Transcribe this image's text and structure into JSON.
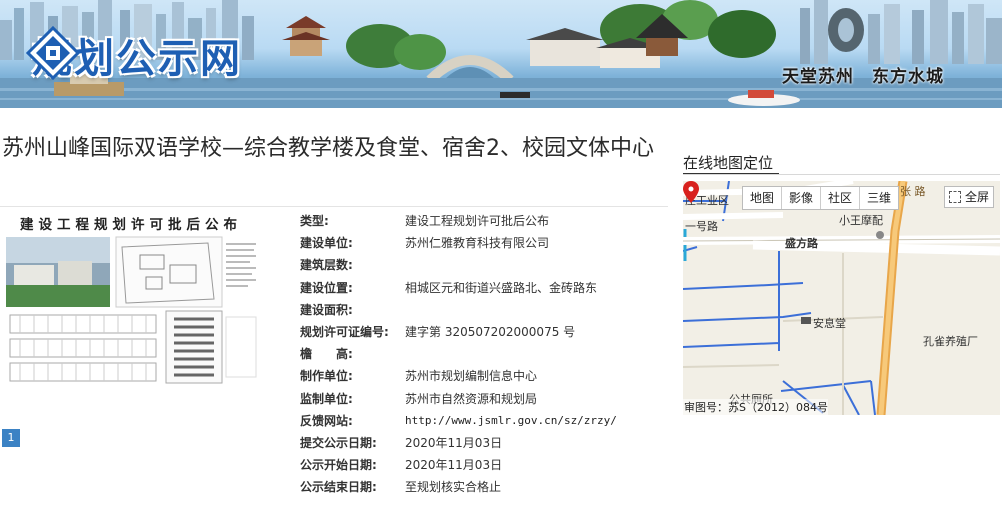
{
  "banner": {
    "logo_text": "规划公示网",
    "slogan_1": "天堂苏州",
    "slogan_2": "东方水城"
  },
  "project": {
    "title": "苏州山峰国际双语学校—综合教学楼及食堂、宿舍2、校园文体中心"
  },
  "thumbnail": {
    "heading": "建设工程规划许可批后公布",
    "page_number": "1"
  },
  "details": [
    {
      "key": "类型:",
      "value": "建设工程规划许可批后公布"
    },
    {
      "key": "建设单位:",
      "value": "苏州仁雅教育科技有限公司"
    },
    {
      "key": "建筑层数:",
      "value": ""
    },
    {
      "key": "建设位置:",
      "value": "相城区元和街道兴盛路北、金砖路东"
    },
    {
      "key": "建设面积:",
      "value": ""
    },
    {
      "key": "规划许可证编号:",
      "value": "建字第 320507202000075 号"
    },
    {
      "key": "檐　　高:",
      "value": ""
    },
    {
      "key": "制作单位:",
      "value": "苏州市规划编制信息中心"
    },
    {
      "key": "监制单位:",
      "value": "苏州市自然资源和规划局"
    },
    {
      "key": "反馈网站:",
      "value": "http://www.jsmlr.gov.cn/sz/zrzy/"
    },
    {
      "key": "提交公示日期:",
      "value": "2020年11月03日"
    },
    {
      "key": "公示开始日期:",
      "value": "2020年11月03日"
    },
    {
      "key": "公示结束日期:",
      "value": "至规划核实合格止"
    }
  ],
  "map": {
    "heading": "在线地图定位",
    "tabs": [
      "地图",
      "影像",
      "社区",
      "三维"
    ],
    "fullscreen": "全屏",
    "labels": {
      "road_1": "庄工业区",
      "road_2": "一号路",
      "road_3": "盛方路",
      "poi_1": "小王摩配",
      "poi_2": "安息堂",
      "poi_3": "孔雀养殖厂",
      "poi_4": "公共厕所",
      "road_v": "张 路"
    },
    "credit": "审图号：苏S（2012）084号"
  }
}
